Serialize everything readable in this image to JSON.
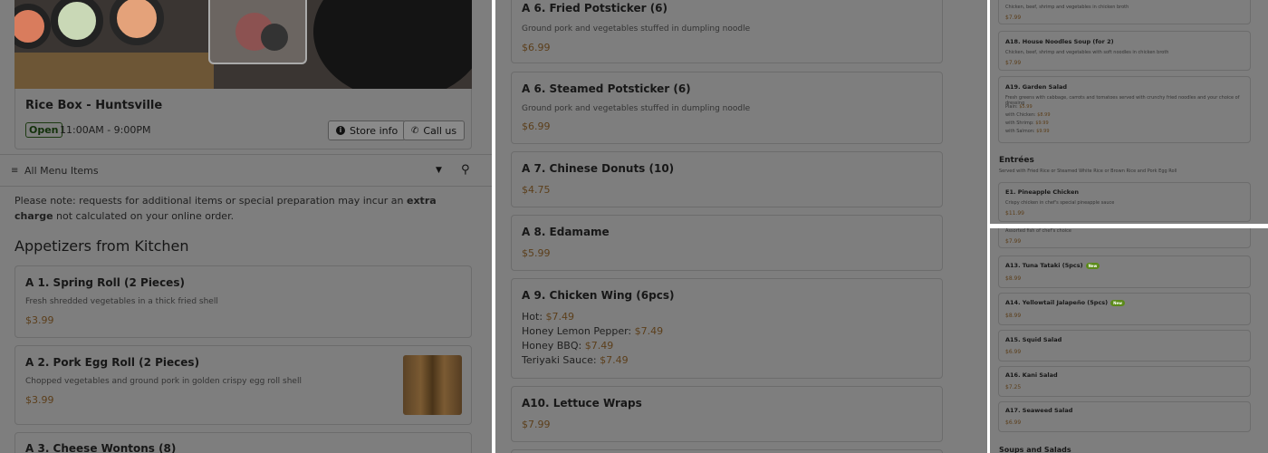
{
  "panel1": {
    "store_name": "Rice Box - Huntsville",
    "open_badge": "Open",
    "hours": "11:00AM - 9:00PM",
    "store_info_label": "Store info",
    "call_label": "Call us",
    "menu_select": "All Menu Items",
    "notice_pre": "Please note: requests for additional items or special preparation may incur an ",
    "notice_bold": "extra charge",
    "notice_post": " not calculated on your online order.",
    "section_title": "Appetizers from Kitchen",
    "items": [
      {
        "name": "A 1. Spring Roll (2 Pieces)",
        "desc": "Fresh shredded vegetables in a thick fried shell",
        "price": "$3.99"
      },
      {
        "name": "A 2. Pork Egg Roll (2 Pieces)",
        "desc": "Chopped vegetables and ground pork in golden crispy egg roll shell",
        "price": "$3.99"
      },
      {
        "name": "A 3. Cheese Wontons (8)"
      }
    ]
  },
  "panel2": {
    "items": [
      {
        "name": "A 6. Fried Potsticker (6)",
        "desc": "Ground pork and vegetables stuffed in dumpling noodle",
        "price": "$6.99"
      },
      {
        "name": "A 6. Steamed Potsticker (6)",
        "desc": "Ground pork and vegetables stuffed in dumpling noodle",
        "price": "$6.99"
      },
      {
        "name": "A 7. Chinese Donuts (10)",
        "price": "$4.75"
      },
      {
        "name": "A 8. Edamame",
        "price": "$5.99"
      },
      {
        "name": "A 9. Chicken Wing (6pcs)",
        "options": [
          {
            "label": "Hot: ",
            "price": "$7.49"
          },
          {
            "label": "Honey Lemon Pepper: ",
            "price": "$7.49"
          },
          {
            "label": "Honey BBQ: ",
            "price": "$7.49"
          },
          {
            "label": "Teriyaki Sauce: ",
            "price": "$7.49"
          }
        ]
      },
      {
        "name": "A10. Lettuce Wraps",
        "price": "$7.99"
      }
    ]
  },
  "panel3": {
    "top_desc": "Chicken, beef, shrimp and vegetables in chicken broth",
    "top_price": "$7.99",
    "items": [
      {
        "name": "A18. House Noodles Soup (for 2)",
        "desc": "Chicken, beef, shrimp and vegetables with soft noodles in chicken broth",
        "price": "$7.99"
      },
      {
        "name": "A19. Garden Salad",
        "desc": "Fresh greens with cabbage, carrots and tomatoes served with crunchy fried noodles and your choice of dressing",
        "options": [
          {
            "label": "Plain: ",
            "price": "$5.99"
          },
          {
            "label": "with Chicken: ",
            "price": "$8.99"
          },
          {
            "label": "with Shrimp: ",
            "price": "$9.99"
          },
          {
            "label": "with Salmon: ",
            "price": "$9.99"
          }
        ]
      }
    ],
    "section_title": "Entrées",
    "section_desc": "Served with Fried Rice or Steamed White Rice or Brown Rice and Pork Egg Roll",
    "entree": {
      "name": "E1. Pineapple Chicken",
      "desc": "Crispy chicken in chef's special pineapple sauce",
      "price": "$11.99"
    }
  },
  "panel4": {
    "top_desc": "Assorted fish of chef's choice",
    "top_price": "$7.99",
    "new_label": "New",
    "items": [
      {
        "name": "A13. Tuna Tataki (5pcs)",
        "new": true,
        "price": "$8.99"
      },
      {
        "name": "A14. Yellowtail Jalapeño (5pcs)",
        "new": true,
        "price": "$8.99"
      },
      {
        "name": "A15. Squid Salad",
        "price": "$6.99"
      },
      {
        "name": "A16. Kani Salad",
        "price": "$7.25"
      },
      {
        "name": "A17. Seaweed Salad",
        "price": "$6.99"
      }
    ],
    "section_title": "Soups and Salads"
  },
  "colors": {
    "overlay": "#7e7e7e",
    "price": "#5c3f1b",
    "open_badge": "#12300a",
    "new_badge": "#5b8a1a"
  }
}
